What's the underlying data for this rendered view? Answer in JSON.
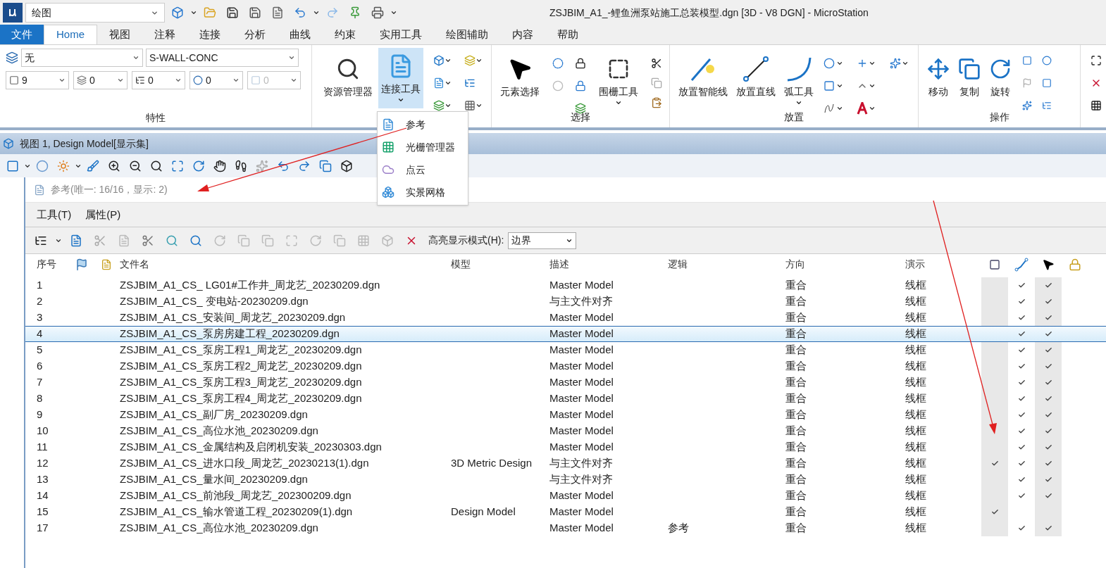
{
  "window": {
    "title": "ZSJBIM_A1_-鲤鱼洲泵站施工总装模型.dgn [3D - V8 DGN] - MicroStation",
    "workflow": "绘图"
  },
  "tabs": [
    {
      "label": "文件",
      "kind": "file",
      "selected": false
    },
    {
      "label": "Home",
      "kind": "tab",
      "selected": true
    },
    {
      "label": "视图",
      "kind": "tab",
      "selected": false
    },
    {
      "label": "注释",
      "kind": "tab",
      "selected": false
    },
    {
      "label": "连接",
      "kind": "tab",
      "selected": false
    },
    {
      "label": "分析",
      "kind": "tab",
      "selected": false
    },
    {
      "label": "曲线",
      "kind": "tab",
      "selected": false
    },
    {
      "label": "约束",
      "kind": "tab",
      "selected": false
    },
    {
      "label": "实用工具",
      "kind": "tab",
      "selected": false
    },
    {
      "label": "绘图辅助",
      "kind": "tab",
      "selected": false
    },
    {
      "label": "内容",
      "kind": "tab",
      "selected": false
    },
    {
      "label": "帮助",
      "kind": "tab",
      "selected": false
    }
  ],
  "ribbon": {
    "properties": {
      "label": "特性",
      "level": "无",
      "style": "S-WALL-CONC",
      "element_color": "9",
      "line_style": "0",
      "weight": "0",
      "transparency": "0",
      "priority": {
        "value": "0",
        "disabled": true
      }
    },
    "connect": {
      "explorer": "资源管理器",
      "attach": "连接工具"
    },
    "select": {
      "label": "选择",
      "element": "元素选择",
      "fence": "围栅工具"
    },
    "place": {
      "label": "放置",
      "smartline": "放置智能线",
      "line": "放置直线",
      "arc": "弧工具"
    },
    "manipulate": {
      "label": "操作",
      "move": "移动",
      "copy": "复制",
      "rotate": "旋转"
    }
  },
  "dropdown_menu": [
    {
      "label": "参考",
      "kind": "reference"
    },
    {
      "label": "光栅管理器",
      "kind": "raster"
    },
    {
      "label": "点云",
      "kind": "cloud"
    },
    {
      "label": "实景网格",
      "kind": "mesh"
    }
  ],
  "view": {
    "title": "视图 1, Design Model[显示集]"
  },
  "references": {
    "title": "参考(唯一: 16/16，显示: 2)",
    "menus": [
      "工具(T)",
      "属性(P)"
    ],
    "highlight_label": "高亮显示模式(H):",
    "highlight_mode": "边界",
    "columns": [
      "序号",
      "文件名",
      "模型",
      "描述",
      "逻辑",
      "方向",
      "演示"
    ],
    "rows": [
      {
        "no": "1",
        "file": "ZSJBIM_A1_CS_ LG01#工作井_周龙艺_20230209.dgn",
        "model": "",
        "description": "Master Model",
        "logic": "",
        "orientation": "重合",
        "presentation": "线框",
        "selected": false,
        "column_10": false,
        "column_11": true,
        "column_12": true
      },
      {
        "no": "2",
        "file": "ZSJBIM_A1_CS_ 变电站-20230209.dgn",
        "model": "",
        "description": "与主文件对齐",
        "logic": "",
        "orientation": "重合",
        "presentation": "线框",
        "selected": false,
        "column_10": false,
        "column_11": true,
        "column_12": true
      },
      {
        "no": "3",
        "file": "ZSJBIM_A1_CS_安装间_周龙艺_20230209.dgn",
        "model": "",
        "description": "Master Model",
        "logic": "",
        "orientation": "重合",
        "presentation": "线框",
        "selected": false,
        "column_10": false,
        "column_11": true,
        "column_12": true
      },
      {
        "no": "4",
        "file": "ZSJBIM_A1_CS_泵房房建工程_20230209.dgn",
        "model": "",
        "description": "Master Model",
        "logic": "",
        "orientation": "重合",
        "presentation": "线框",
        "selected": true,
        "column_10": false,
        "column_11": true,
        "column_12": true
      },
      {
        "no": "5",
        "file": "ZSJBIM_A1_CS_泵房工程1_周龙艺_20230209.dgn",
        "model": "",
        "description": "Master Model",
        "logic": "",
        "orientation": "重合",
        "presentation": "线框",
        "selected": false,
        "column_10": false,
        "column_11": true,
        "column_12": true
      },
      {
        "no": "6",
        "file": "ZSJBIM_A1_CS_泵房工程2_周龙艺_20230209.dgn",
        "model": "",
        "description": "Master Model",
        "logic": "",
        "orientation": "重合",
        "presentation": "线框",
        "selected": false,
        "column_10": false,
        "column_11": true,
        "column_12": true
      },
      {
        "no": "7",
        "file": "ZSJBIM_A1_CS_泵房工程3_周龙艺_20230209.dgn",
        "model": "",
        "description": "Master Model",
        "logic": "",
        "orientation": "重合",
        "presentation": "线框",
        "selected": false,
        "column_10": false,
        "column_11": true,
        "column_12": true
      },
      {
        "no": "8",
        "file": "ZSJBIM_A1_CS_泵房工程4_周龙艺_20230209.dgn",
        "model": "",
        "description": "Master Model",
        "logic": "",
        "orientation": "重合",
        "presentation": "线框",
        "selected": false,
        "column_10": false,
        "column_11": true,
        "column_12": true
      },
      {
        "no": "9",
        "file": "ZSJBIM_A1_CS_副厂房_20230209.dgn",
        "model": "",
        "description": "Master Model",
        "logic": "",
        "orientation": "重合",
        "presentation": "线框",
        "selected": false,
        "column_10": false,
        "column_11": true,
        "column_12": true
      },
      {
        "no": "10",
        "file": "ZSJBIM_A1_CS_高位水池_20230209.dgn",
        "model": "",
        "description": "Master Model",
        "logic": "",
        "orientation": "重合",
        "presentation": "线框",
        "selected": false,
        "column_10": false,
        "column_11": true,
        "column_12": true
      },
      {
        "no": "11",
        "file": "ZSJBIM_A1_CS_金属结构及启闭机安装_20230303.dgn",
        "model": "",
        "description": "Master Model",
        "logic": "",
        "orientation": "重合",
        "presentation": "线框",
        "selected": false,
        "column_10": false,
        "column_11": true,
        "column_12": true
      },
      {
        "no": "12",
        "file": "ZSJBIM_A1_CS_进水口段_周龙艺_20230213(1).dgn",
        "model": "3D Metric Design",
        "description": "与主文件对齐",
        "logic": "",
        "orientation": "重合",
        "presentation": "线框",
        "selected": false,
        "column_10": true,
        "column_11": true,
        "column_12": true
      },
      {
        "no": "13",
        "file": "ZSJBIM_A1_CS_量水间_20230209.dgn",
        "model": "",
        "description": "与主文件对齐",
        "logic": "",
        "orientation": "重合",
        "presentation": "线框",
        "selected": false,
        "column_10": false,
        "column_11": true,
        "column_12": true
      },
      {
        "no": "14",
        "file": "ZSJBIM_A1_CS_前池段_周龙艺_202300209.dgn",
        "model": "",
        "description": "Master Model",
        "logic": "",
        "orientation": "重合",
        "presentation": "线框",
        "selected": false,
        "column_10": false,
        "column_11": true,
        "column_12": true
      },
      {
        "no": "15",
        "file": "ZSJBIM_A1_CS_输水管道工程_20230209(1).dgn",
        "model": "Design Model",
        "description": "Master Model",
        "logic": "",
        "orientation": "重合",
        "presentation": "线框",
        "selected": false,
        "column_10": true,
        "column_11": false,
        "column_12": false
      },
      {
        "no": "17",
        "file": "ZSJBIM_A1_CS_高位水池_20230209.dgn",
        "model": "",
        "description": "Master Model",
        "logic": "参考",
        "orientation": "重合",
        "presentation": "线框",
        "selected": false,
        "column_10": false,
        "column_11": true,
        "column_12": true
      }
    ]
  }
}
